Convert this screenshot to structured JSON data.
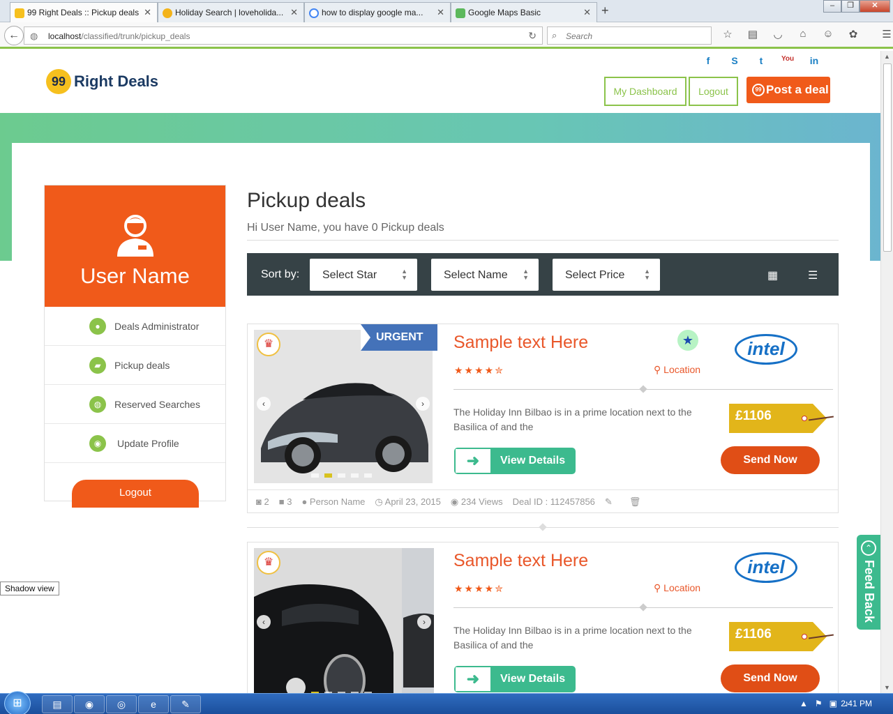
{
  "browser": {
    "tabs": [
      {
        "title": "99 Right Deals :: Pickup deals",
        "active": true,
        "favicon_color": "#f6c01e"
      },
      {
        "title": "Holiday Search | loveholida...",
        "active": false,
        "favicon_color": "#f3b31a"
      },
      {
        "title": "how to display google ma...",
        "active": false,
        "favicon_color": "#4285f4"
      },
      {
        "title": "Google Maps Basic",
        "active": false,
        "favicon_color": "#5cb85c"
      }
    ],
    "new_tab": "+",
    "url_host": "localhost",
    "url_path": "/classified/trunk/pickup_deals",
    "search_placeholder": "Search"
  },
  "site": {
    "logo_mark": "99",
    "logo_text": "Right Deals",
    "social": [
      "f",
      "S",
      "t",
      "You",
      "in"
    ],
    "header_buttons": {
      "dashboard": "My Dashboard",
      "logout": "Logout",
      "post": "Post a deal"
    },
    "accent_color": "#f05a1a",
    "green_color": "#8bc34a"
  },
  "sidebar": {
    "username": "User Name",
    "items": [
      {
        "label": "Deals Administrator",
        "icon": "user-icon"
      },
      {
        "label": "Pickup deals",
        "icon": "folder-icon"
      },
      {
        "label": "Reserved Searches",
        "icon": "globe-icon"
      },
      {
        "label": "Update Profile",
        "icon": "profile-icon"
      }
    ],
    "logout": "Logout"
  },
  "main": {
    "title": "Pickup deals",
    "subtitle": "Hi User Name, you have 0 Pickup deals",
    "sort_label": "Sort by:",
    "sort_selects": [
      "Select Star",
      "Select Name",
      "Select Price"
    ]
  },
  "deals": [
    {
      "badge": "URGENT",
      "title": "Sample text Here",
      "stars": "★★★★✮",
      "location": "Location",
      "brand": "intel",
      "description": "The Holiday Inn Bilbao is in a prime location next to the Basilica of and the",
      "price": "£1106",
      "view_label": "View Details",
      "send_label": "Send Now",
      "photos": "2",
      "videos": "3",
      "person": "Person Name",
      "date": "April 23, 2015",
      "views": "234 Views",
      "deal_id": "Deal ID : 112457856"
    },
    {
      "title": "Sample text Here",
      "stars": "★★★★✮",
      "location": "Location",
      "brand": "intel",
      "description": "The Holiday Inn Bilbao is in a prime location next to the Basilica of and the",
      "price": "£1106",
      "view_label": "View Details",
      "send_label": "Send Now"
    }
  ],
  "feedback": "Feed Back",
  "shadow_view": "Shadow view",
  "taskbar": {
    "time": "2:41 PM"
  }
}
